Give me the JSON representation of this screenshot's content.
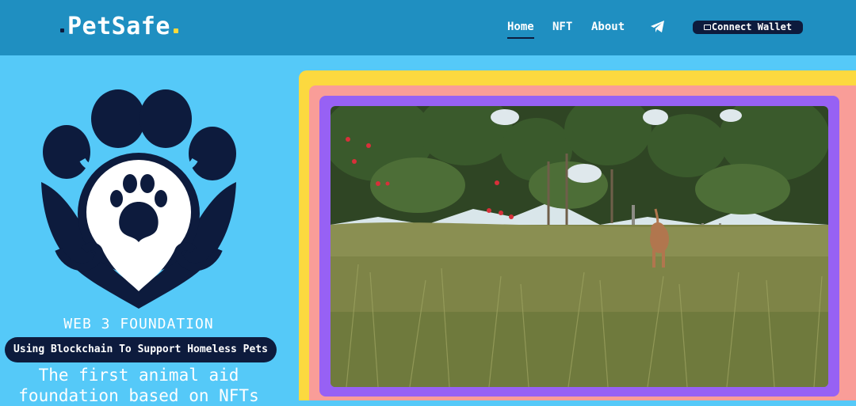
{
  "header": {
    "logo": "PetSafe",
    "nav": [
      {
        "label": "Home",
        "active": true
      },
      {
        "label": "NFT"
      },
      {
        "label": "About"
      }
    ],
    "telegram_icon": "telegram-icon",
    "connect_wallet": "Connect Wallet",
    "wallet_icon": "wallet-icon"
  },
  "hero": {
    "subtitle": "WEB 3 FOUNDATION",
    "tagline": "Using Blockchain To Support Homeless Pets",
    "headline_line1": "The first animal aid",
    "headline_line2": "foundation based on NFTs"
  },
  "video": {
    "description_icon": "dog-in-field-video"
  },
  "colors": {
    "navbar": "#1f8fc1",
    "page_bg": "#55c9f8",
    "navy": "#0d1b3d",
    "frame_yellow": "#fcd93f",
    "frame_pink": "#f99d98",
    "frame_purple": "#9761f4"
  }
}
